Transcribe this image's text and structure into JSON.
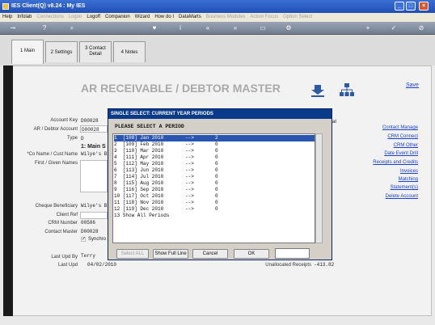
{
  "titlebar": {
    "title": "IES Client(Q) v8.24 : My IES"
  },
  "menu": {
    "items": [
      {
        "label": "Help",
        "enabled": true
      },
      {
        "label": "Infolab",
        "enabled": true
      },
      {
        "label": "Connections",
        "enabled": false
      },
      {
        "label": "Logon",
        "enabled": false
      },
      {
        "label": "Logoff",
        "enabled": true
      },
      {
        "label": "Companion",
        "enabled": true
      },
      {
        "label": "Wizard",
        "enabled": true
      },
      {
        "label": "How do I",
        "enabled": true
      },
      {
        "label": "DataMarts",
        "enabled": true
      },
      {
        "label": "Business Modules",
        "enabled": false
      },
      {
        "label": "Action Focus",
        "enabled": false
      },
      {
        "label": "Option Select",
        "enabled": false
      }
    ]
  },
  "tabs": [
    {
      "label": "1 Main",
      "active": true
    },
    {
      "label": "2 Settings",
      "active": false
    },
    {
      "label": "3 Contact Detail",
      "active": false
    },
    {
      "label": "4 Notes",
      "active": false
    }
  ],
  "page": {
    "title": "AR RECEIVABLE / DEBTOR MASTER",
    "save_link": "Save"
  },
  "form": {
    "account_key_label": "Account Key",
    "account_key": "D00028",
    "debtor_account_label": "AR / Debtor Account",
    "debtor_account": "D00028",
    "type_label": "Type",
    "type": "D",
    "section_label": "1: Main S",
    "co_name_label": "*Co Name / Cust Name",
    "co_name": "Wilye's B",
    "first_names_label": "First / Given Names",
    "cheque_beneficiary_label": "Cheque Beneficiary",
    "cheque_beneficiary": "Wilye's B",
    "client_ref_label": "Client Ref",
    "crm_number_label": "CRM Number",
    "crm_number": "00586",
    "contact_master_label": "Contact Master",
    "contact_master": "D00028",
    "synchro_label": "Synchro",
    "last_upd_by_label": "Last Upd By",
    "last_upd_by": "Terry",
    "last_upd_label": "Last Upd",
    "last_upd": "04/02/2010",
    "unallocated_label": "Unallocated Receipts",
    "unallocated": "-413.82",
    "right_partial": "at"
  },
  "right_links": [
    "Contact Manage",
    "CRM Connect",
    "CRM Other",
    "Date Event Drill",
    "Receipts and Credits",
    "Invoices",
    "Matching",
    "Statement(s)",
    "Delete Account"
  ],
  "dialog": {
    "title": "SINGLE SELECT: CURRENT YEAR PERIODS",
    "prompt": "PLEASE SELECT A PERIOD",
    "rows": [
      {
        "a": "1  [108] Jan 2010",
        "b": "-->",
        "c": "2"
      },
      {
        "a": "2  [109] Feb 2010",
        "b": "-->",
        "c": "0"
      },
      {
        "a": "3  [110] Mar 2010",
        "b": "-->",
        "c": "0"
      },
      {
        "a": "4  [111] Apr 2010",
        "b": "-->",
        "c": "0"
      },
      {
        "a": "5  [112] May 2010",
        "b": "-->",
        "c": "0"
      },
      {
        "a": "6  [113] Jun 2010",
        "b": "-->",
        "c": "0"
      },
      {
        "a": "7  [114] Jul 2010",
        "b": "-->",
        "c": "0"
      },
      {
        "a": "8  [115] Aug 2010",
        "b": "-->",
        "c": "0"
      },
      {
        "a": "9  [116] Sep 2010",
        "b": "-->",
        "c": "0"
      },
      {
        "a": "10 [117] Oct 2010",
        "b": "-->",
        "c": "0"
      },
      {
        "a": "11 [118] Nov 2010",
        "b": "-->",
        "c": "0"
      },
      {
        "a": "12 [119] Dec 2010",
        "b": "-->",
        "c": "0"
      },
      {
        "a": "13 Show All Periods",
        "b": "",
        "c": ""
      }
    ],
    "selected_index": 0,
    "buttons": {
      "select_all": "Select ALL",
      "show_full": "Show Full Line",
      "cancel": "Cancel",
      "ok": "OK"
    }
  },
  "colors": {
    "selection": "#2a55b0",
    "link": "#1a3fcc",
    "title_bar": "#1f4fb4"
  }
}
